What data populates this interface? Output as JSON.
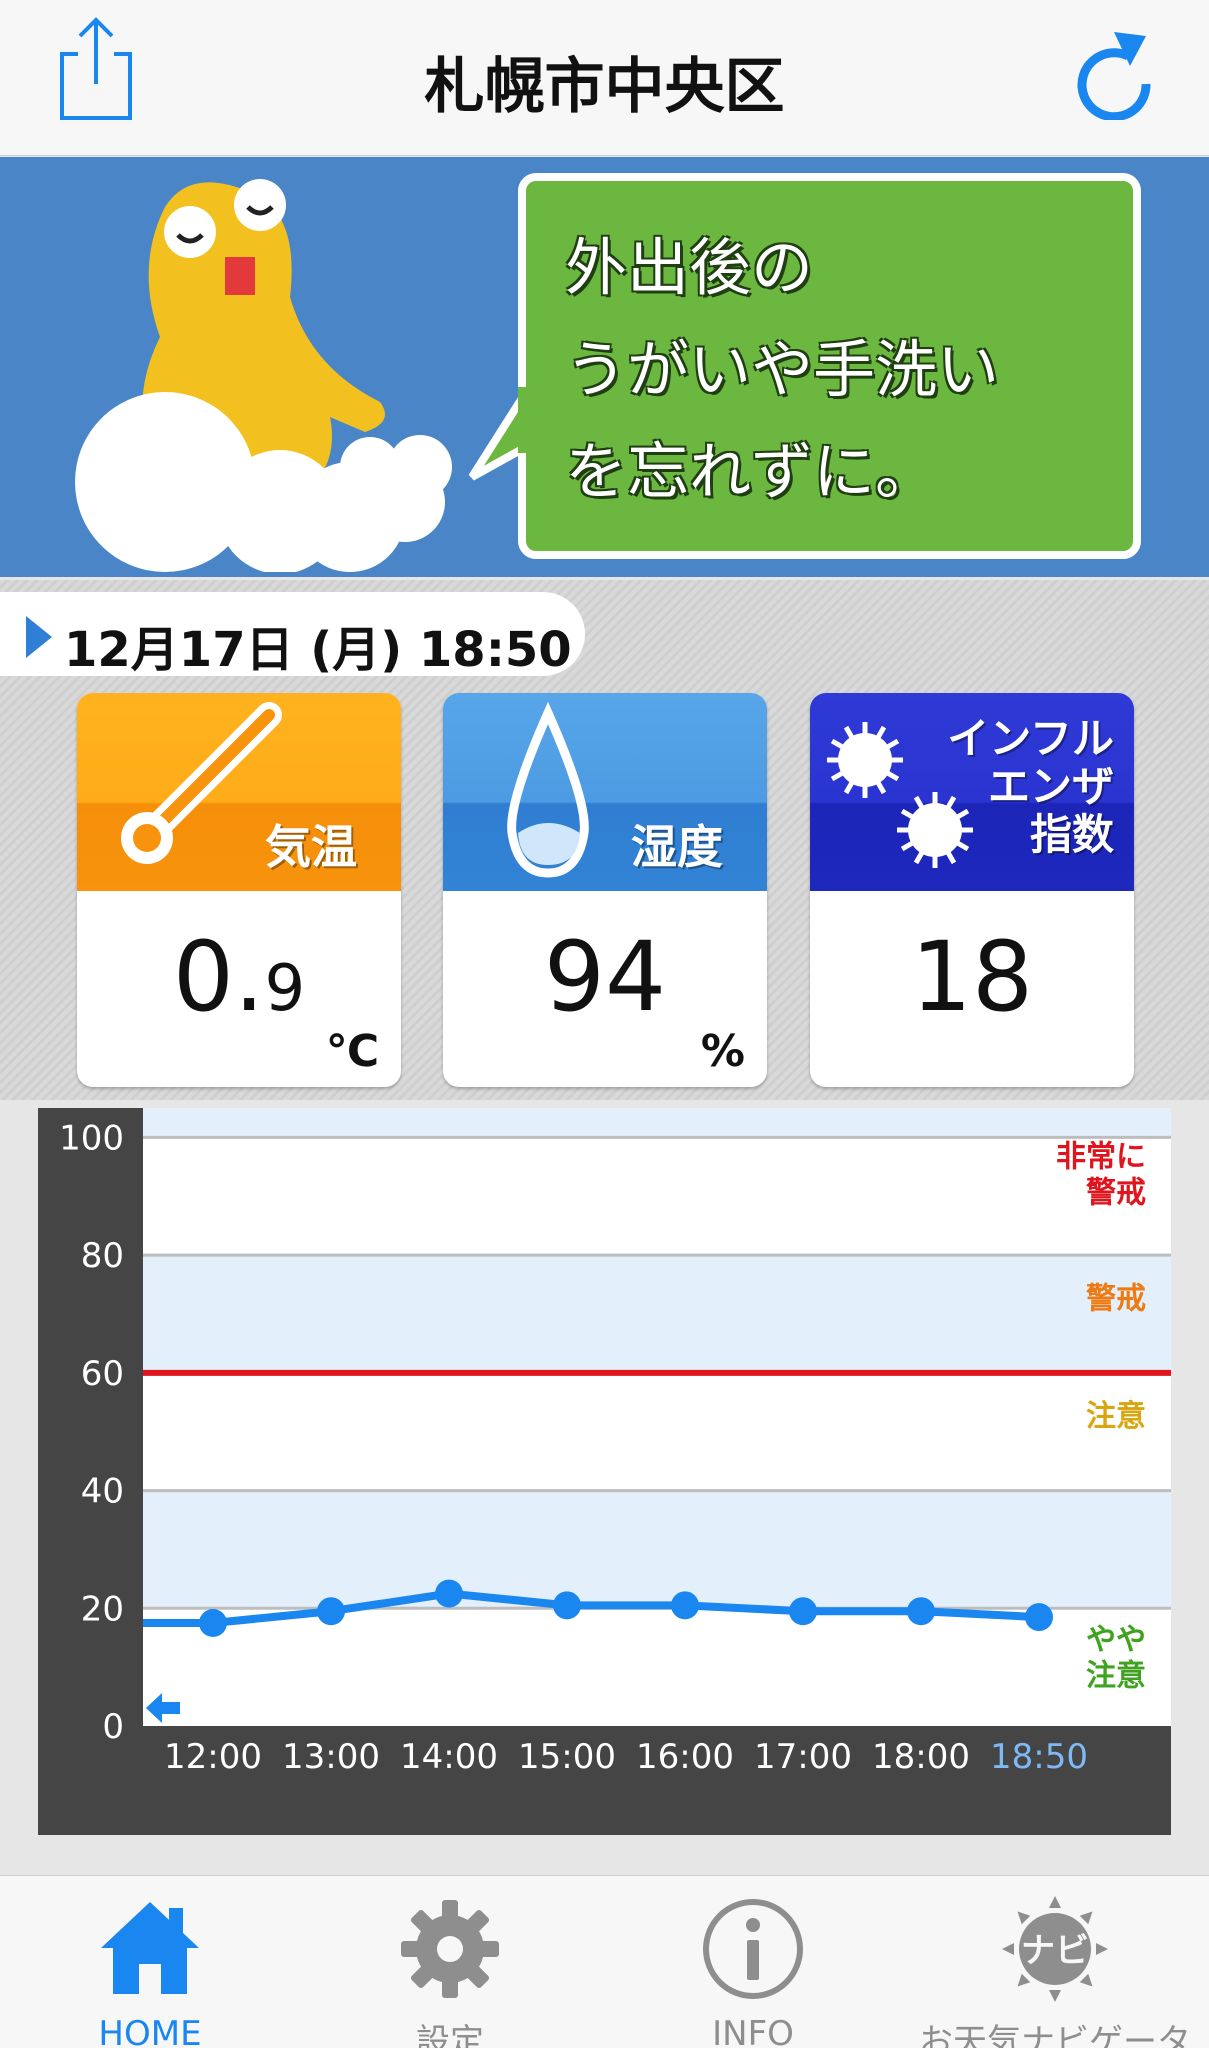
{
  "nav": {
    "title": "札幌市中央区",
    "share_icon": "share-icon",
    "refresh_icon": "refresh-icon"
  },
  "banner": {
    "message_lines": [
      "外出後の",
      "うがいや手洗い",
      "を忘れずに。"
    ]
  },
  "info": {
    "datetime": "12月17日 (月) 18:50",
    "cards": {
      "temperature": {
        "label": "気温",
        "value": "0.9",
        "unit": "℃",
        "icon": "thermometer-icon"
      },
      "humidity": {
        "label": "湿度",
        "value": "94",
        "unit": "%",
        "icon": "water-drop-icon"
      },
      "influenza": {
        "label_lines": [
          "インフル",
          "エンザ",
          "指数"
        ],
        "value": "18",
        "icon": "virus-icon"
      }
    }
  },
  "chart_data": {
    "type": "line",
    "x": [
      "12:00",
      "13:00",
      "14:00",
      "15:00",
      "16:00",
      "17:00",
      "18:00",
      "18:50"
    ],
    "y_ticks": [
      "100",
      "80",
      "60",
      "40",
      "20",
      "0"
    ],
    "ylim": [
      0,
      100
    ],
    "series": [
      {
        "values": [
          17.5,
          19.5,
          22.5,
          20.5,
          20.5,
          19.5,
          19.5,
          18.5
        ]
      }
    ],
    "level_labels": [
      {
        "lines": [
          "非常に",
          "警戒"
        ],
        "color": "#e0141c"
      },
      {
        "lines": [
          "警戒"
        ],
        "color": "#ee7a12"
      },
      {
        "lines": [
          "注意"
        ],
        "color": "#d9a612"
      },
      {
        "lines": [
          "やや",
          "注意"
        ],
        "color": "#3fa320"
      }
    ],
    "threshold": 60,
    "threshold_color": "#e0141c",
    "line_color": "#1a86f0",
    "highlight_color": "#7fb9f5",
    "back_icon": "back-arrow-icon"
  },
  "tabs": [
    {
      "label": "HOME",
      "icon": "home-icon",
      "active": true
    },
    {
      "label": "設定",
      "icon": "gear-icon",
      "active": false
    },
    {
      "label": "INFO",
      "icon": "info-icon",
      "active": false
    },
    {
      "label": "お天気ナビゲータ",
      "icon": "navi-icon",
      "active": false
    }
  ],
  "colors": {
    "accent": "#1a86f0",
    "banner_bg": "#4a86c7",
    "bubble": "#6cb73f"
  }
}
